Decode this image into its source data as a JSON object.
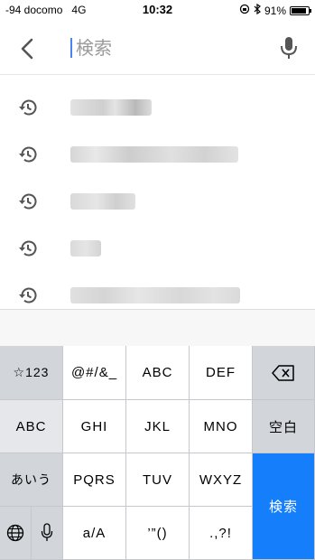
{
  "status": {
    "carrier": "-94 docomo",
    "network": "4G",
    "time": "10:32",
    "battery": "91%",
    "battery_level": 0.91
  },
  "search": {
    "placeholder": "検索"
  },
  "history": {
    "item_count": 5
  },
  "keyboard": {
    "row1": [
      "☆123",
      "@#/&_",
      "ABC",
      "DEF"
    ],
    "row2": [
      "ABC",
      "GHI",
      "JKL",
      "MNO",
      "空白"
    ],
    "row3": [
      "あいう",
      "PQRS",
      "TUV",
      "WXYZ"
    ],
    "row4": [
      "a/A",
      "’”()",
      ".,?!"
    ],
    "search_key": "検索"
  },
  "colors": {
    "accent": "#147efb",
    "cursor": "#4b84f0",
    "icon": "#555555",
    "keyboard_bg": "#bcc1c7"
  }
}
